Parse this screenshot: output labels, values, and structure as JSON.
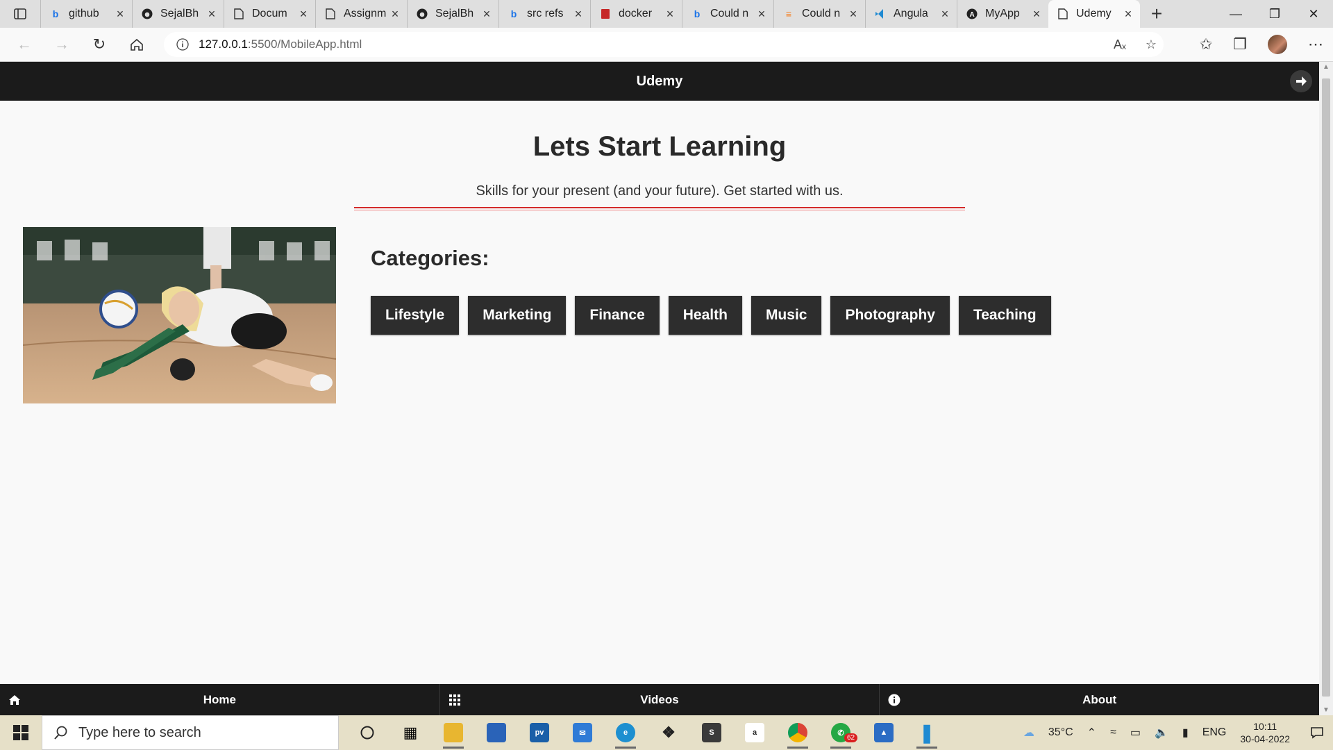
{
  "browser": {
    "tabs": [
      {
        "title": "github",
        "icon": "bing-icon"
      },
      {
        "title": "SejalBh",
        "icon": "github-icon"
      },
      {
        "title": "Docum",
        "icon": "document-icon"
      },
      {
        "title": "Assignm",
        "icon": "document-icon"
      },
      {
        "title": "SejalBh",
        "icon": "github-icon"
      },
      {
        "title": "src refs",
        "icon": "bing-icon"
      },
      {
        "title": "docker",
        "icon": "pdf-icon"
      },
      {
        "title": "Could n",
        "icon": "bing-icon"
      },
      {
        "title": "Could n",
        "icon": "stackoverflow-icon"
      },
      {
        "title": "Angula",
        "icon": "vscode-icon"
      },
      {
        "title": "MyApp",
        "icon": "angular-icon"
      }
    ],
    "active_tab": {
      "title": "Udemy",
      "icon": "document-icon"
    },
    "url_host": "127.0.0.1",
    "url_path": ":5500/MobileApp.html"
  },
  "app": {
    "brand": "Udemy",
    "hero_title": "Lets Start Learning",
    "hero_subtitle": "Skills for your present (and your future). Get started with us.",
    "categories_heading": "Categories:",
    "categories": [
      "Lifestyle",
      "Marketing",
      "Finance",
      "Health",
      "Music",
      "Photography",
      "Teaching"
    ],
    "bottom_nav": [
      {
        "label": "Home",
        "icon": "home-icon"
      },
      {
        "label": "Videos",
        "icon": "grid-icon"
      },
      {
        "label": "About",
        "icon": "info-icon"
      }
    ]
  },
  "taskbar": {
    "search_placeholder": "Type here to search",
    "weather": "35°C",
    "language": "ENG",
    "time": "10:11",
    "date": "30-04-2022",
    "whatsapp_badge": "62"
  },
  "colors": {
    "header_bg": "#1b1b1b",
    "accent_rule": "#d42b2b",
    "button_bg": "#2d2d2d"
  }
}
